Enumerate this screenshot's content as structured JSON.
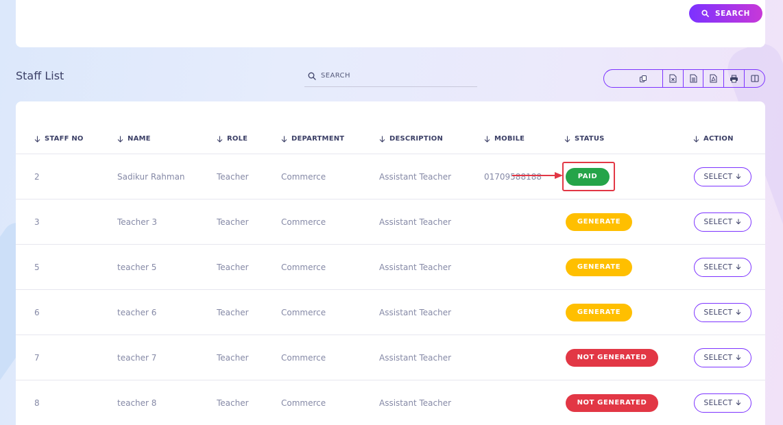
{
  "search_card": {
    "search_button_label": "SEARCH"
  },
  "page_title": "Staff List",
  "table_search": {
    "placeholder": "SEARCH"
  },
  "export_buttons": [
    "copy-icon",
    "excel-icon",
    "csv-icon",
    "pdf-icon",
    "print-icon",
    "columns-icon"
  ],
  "table": {
    "columns": [
      "STAFF NO",
      "NAME",
      "ROLE",
      "DEPARTMENT",
      "DESCRIPTION",
      "MOBILE",
      "STATUS",
      "ACTION"
    ],
    "rows": [
      {
        "staff_no": "2",
        "name": "Sadikur Rahman",
        "role": "Teacher",
        "department": "Commerce",
        "description": "Assistant Teacher",
        "mobile": "01709588188",
        "status": "PAID",
        "action": "SELECT"
      },
      {
        "staff_no": "3",
        "name": "Teacher 3",
        "role": "Teacher",
        "department": "Commerce",
        "description": "Assistant Teacher",
        "mobile": "",
        "status": "GENERATE",
        "action": "SELECT"
      },
      {
        "staff_no": "5",
        "name": "teacher 5",
        "role": "Teacher",
        "department": "Commerce",
        "description": "Assistant Teacher",
        "mobile": "",
        "status": "GENERATE",
        "action": "SELECT"
      },
      {
        "staff_no": "6",
        "name": "teacher 6",
        "role": "Teacher",
        "department": "Commerce",
        "description": "Assistant Teacher",
        "mobile": "",
        "status": "GENERATE",
        "action": "SELECT"
      },
      {
        "staff_no": "7",
        "name": "teacher 7",
        "role": "Teacher",
        "department": "Commerce",
        "description": "Assistant Teacher",
        "mobile": "",
        "status": "NOT GENERATED",
        "action": "SELECT"
      },
      {
        "staff_no": "8",
        "name": "teacher 8",
        "role": "Teacher",
        "department": "Commerce",
        "description": "Assistant Teacher",
        "mobile": "",
        "status": "NOT GENERATED",
        "action": "SELECT"
      }
    ]
  },
  "colors": {
    "accent": "#7c32ff",
    "paid": "#25a449",
    "generate": "#ffbf00",
    "not_generated": "#e23745",
    "annotation": "#e23745"
  }
}
